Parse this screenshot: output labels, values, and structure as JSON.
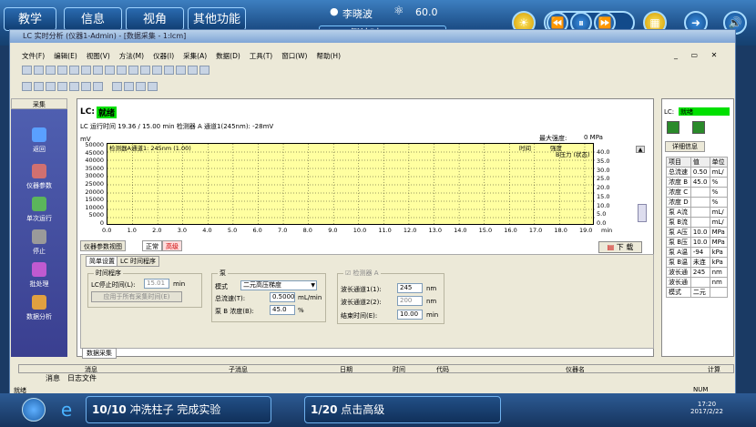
{
  "topbar": {
    "tabs": [
      "教学",
      "信息",
      "视角",
      "其他功能"
    ],
    "user": "李晓波",
    "score": "60.0",
    "countdown": "倒计时: 42:01"
  },
  "window": {
    "title": "LC 实时分析 (仪器1-Admin) - [数据采集 - 1:lcm]",
    "menu": [
      "文件(F)",
      "编辑(E)",
      "视图(V)",
      "方法(M)",
      "仪器(I)",
      "采集(A)",
      "数据(D)",
      "工具(T)",
      "窗口(W)",
      "帮助(H)"
    ]
  },
  "left": {
    "header": "采集",
    "items": [
      "返回",
      "仪器参数",
      "单次运行",
      "停止",
      "批处理",
      "数据分析"
    ]
  },
  "status": {
    "label": "LC:",
    "value": "就绪",
    "runtime": "LC 运行时间  19.36 / 15.00 min 检测器 A 通道1(245nm): -28mV"
  },
  "chart": {
    "unit": "mV",
    "maxpress_label": "最大强度:",
    "maxpress_value": "0 MPa",
    "trace_label": "检测器A通道1: 245nm (1.00)",
    "col_time": "时间",
    "col_conc": "强度",
    "pressure_label": "B压力 (状态)",
    "yticks": [
      "50000",
      "45000",
      "40000",
      "35000",
      "30000",
      "25000",
      "20000",
      "15000",
      "10000",
      "5000",
      "0"
    ],
    "rticks": [
      "40.0",
      "35.0",
      "30.0",
      "25.0",
      "20.0",
      "15.0",
      "10.0",
      "5.0",
      "0.0"
    ],
    "xticks": [
      "0.0",
      "1.0",
      "2.0",
      "3.0",
      "4.0",
      "5.0",
      "6.0",
      "7.0",
      "8.0",
      "9.0",
      "10.0",
      "11.0",
      "12.0",
      "13.0",
      "14.0",
      "15.0",
      "16.0",
      "17.0",
      "18.0",
      "19.0"
    ],
    "xunit": "min"
  },
  "tabs": {
    "t1": "仪器参数视图",
    "t2": "正常",
    "t3": "高级",
    "sub1": "简单设置",
    "sub2": "LC 时间程序",
    "download": "下 载"
  },
  "form": {
    "g_time": "时间程序",
    "stop_label": "LC停止时间(L):",
    "stop_val": "15.01",
    "min": "min",
    "apply": "应用于所有采集时间(E)",
    "g_pump": "泵",
    "mode_label": "模式",
    "mode_val": "二元高压梯度",
    "flow_label": "总流速(T):",
    "flow_val": "0.5000",
    "flow_unit": "mL/min",
    "conc_label": "泵 B 浓度(B):",
    "conc_val": "45.0",
    "pct": "%",
    "g_det": "检测器 A",
    "wl1_label": "波长通道1(1):",
    "wl1_val": "245",
    "wl2_label": "波长通道2(2):",
    "wl2_val": "200",
    "nm": "nm",
    "end_label": "结束时间(E):",
    "end_val": "10.00"
  },
  "bottom": {
    "tab": "数据采集",
    "cols": [
      "消息",
      "子消息",
      "日期",
      "时间",
      "代码",
      "仪器名",
      "计算"
    ],
    "tab_msg": "消息",
    "tab_log": "日志文件"
  },
  "right": {
    "label": "LC:",
    "status": "就绪",
    "detail": "详细信息",
    "headers": [
      "项目",
      "值",
      "单位"
    ],
    "rows": [
      [
        "总流速",
        "0.50",
        "mL/"
      ],
      [
        "浓度 B",
        "45.0",
        "%"
      ],
      [
        "浓度 C",
        "",
        "%"
      ],
      [
        "浓度 D",
        "",
        "%"
      ],
      [
        "泵 A流",
        "",
        "mL/"
      ],
      [
        "泵 B流",
        "",
        "mL/"
      ],
      [
        "泵 A压",
        "10.0",
        "MPa"
      ],
      [
        "泵 B压",
        "10.0",
        "MPa"
      ],
      [
        "泵 A温",
        "-94",
        "kPa"
      ],
      [
        "泵 B温",
        "未连",
        "kPa"
      ],
      [
        "波长通",
        "245",
        "nm"
      ],
      [
        "波长通",
        "",
        "nm"
      ],
      [
        "模式",
        "二元",
        ""
      ]
    ]
  },
  "statusbar": {
    "left": "就绪",
    "num": "NUM"
  },
  "taskbar": {
    "task1_count": "10/10",
    "task1": "冲洗柱子 完成实验",
    "task2_count": "1/20",
    "task2": "点击高级",
    "time": "17:20",
    "date": "2017/2/22"
  }
}
